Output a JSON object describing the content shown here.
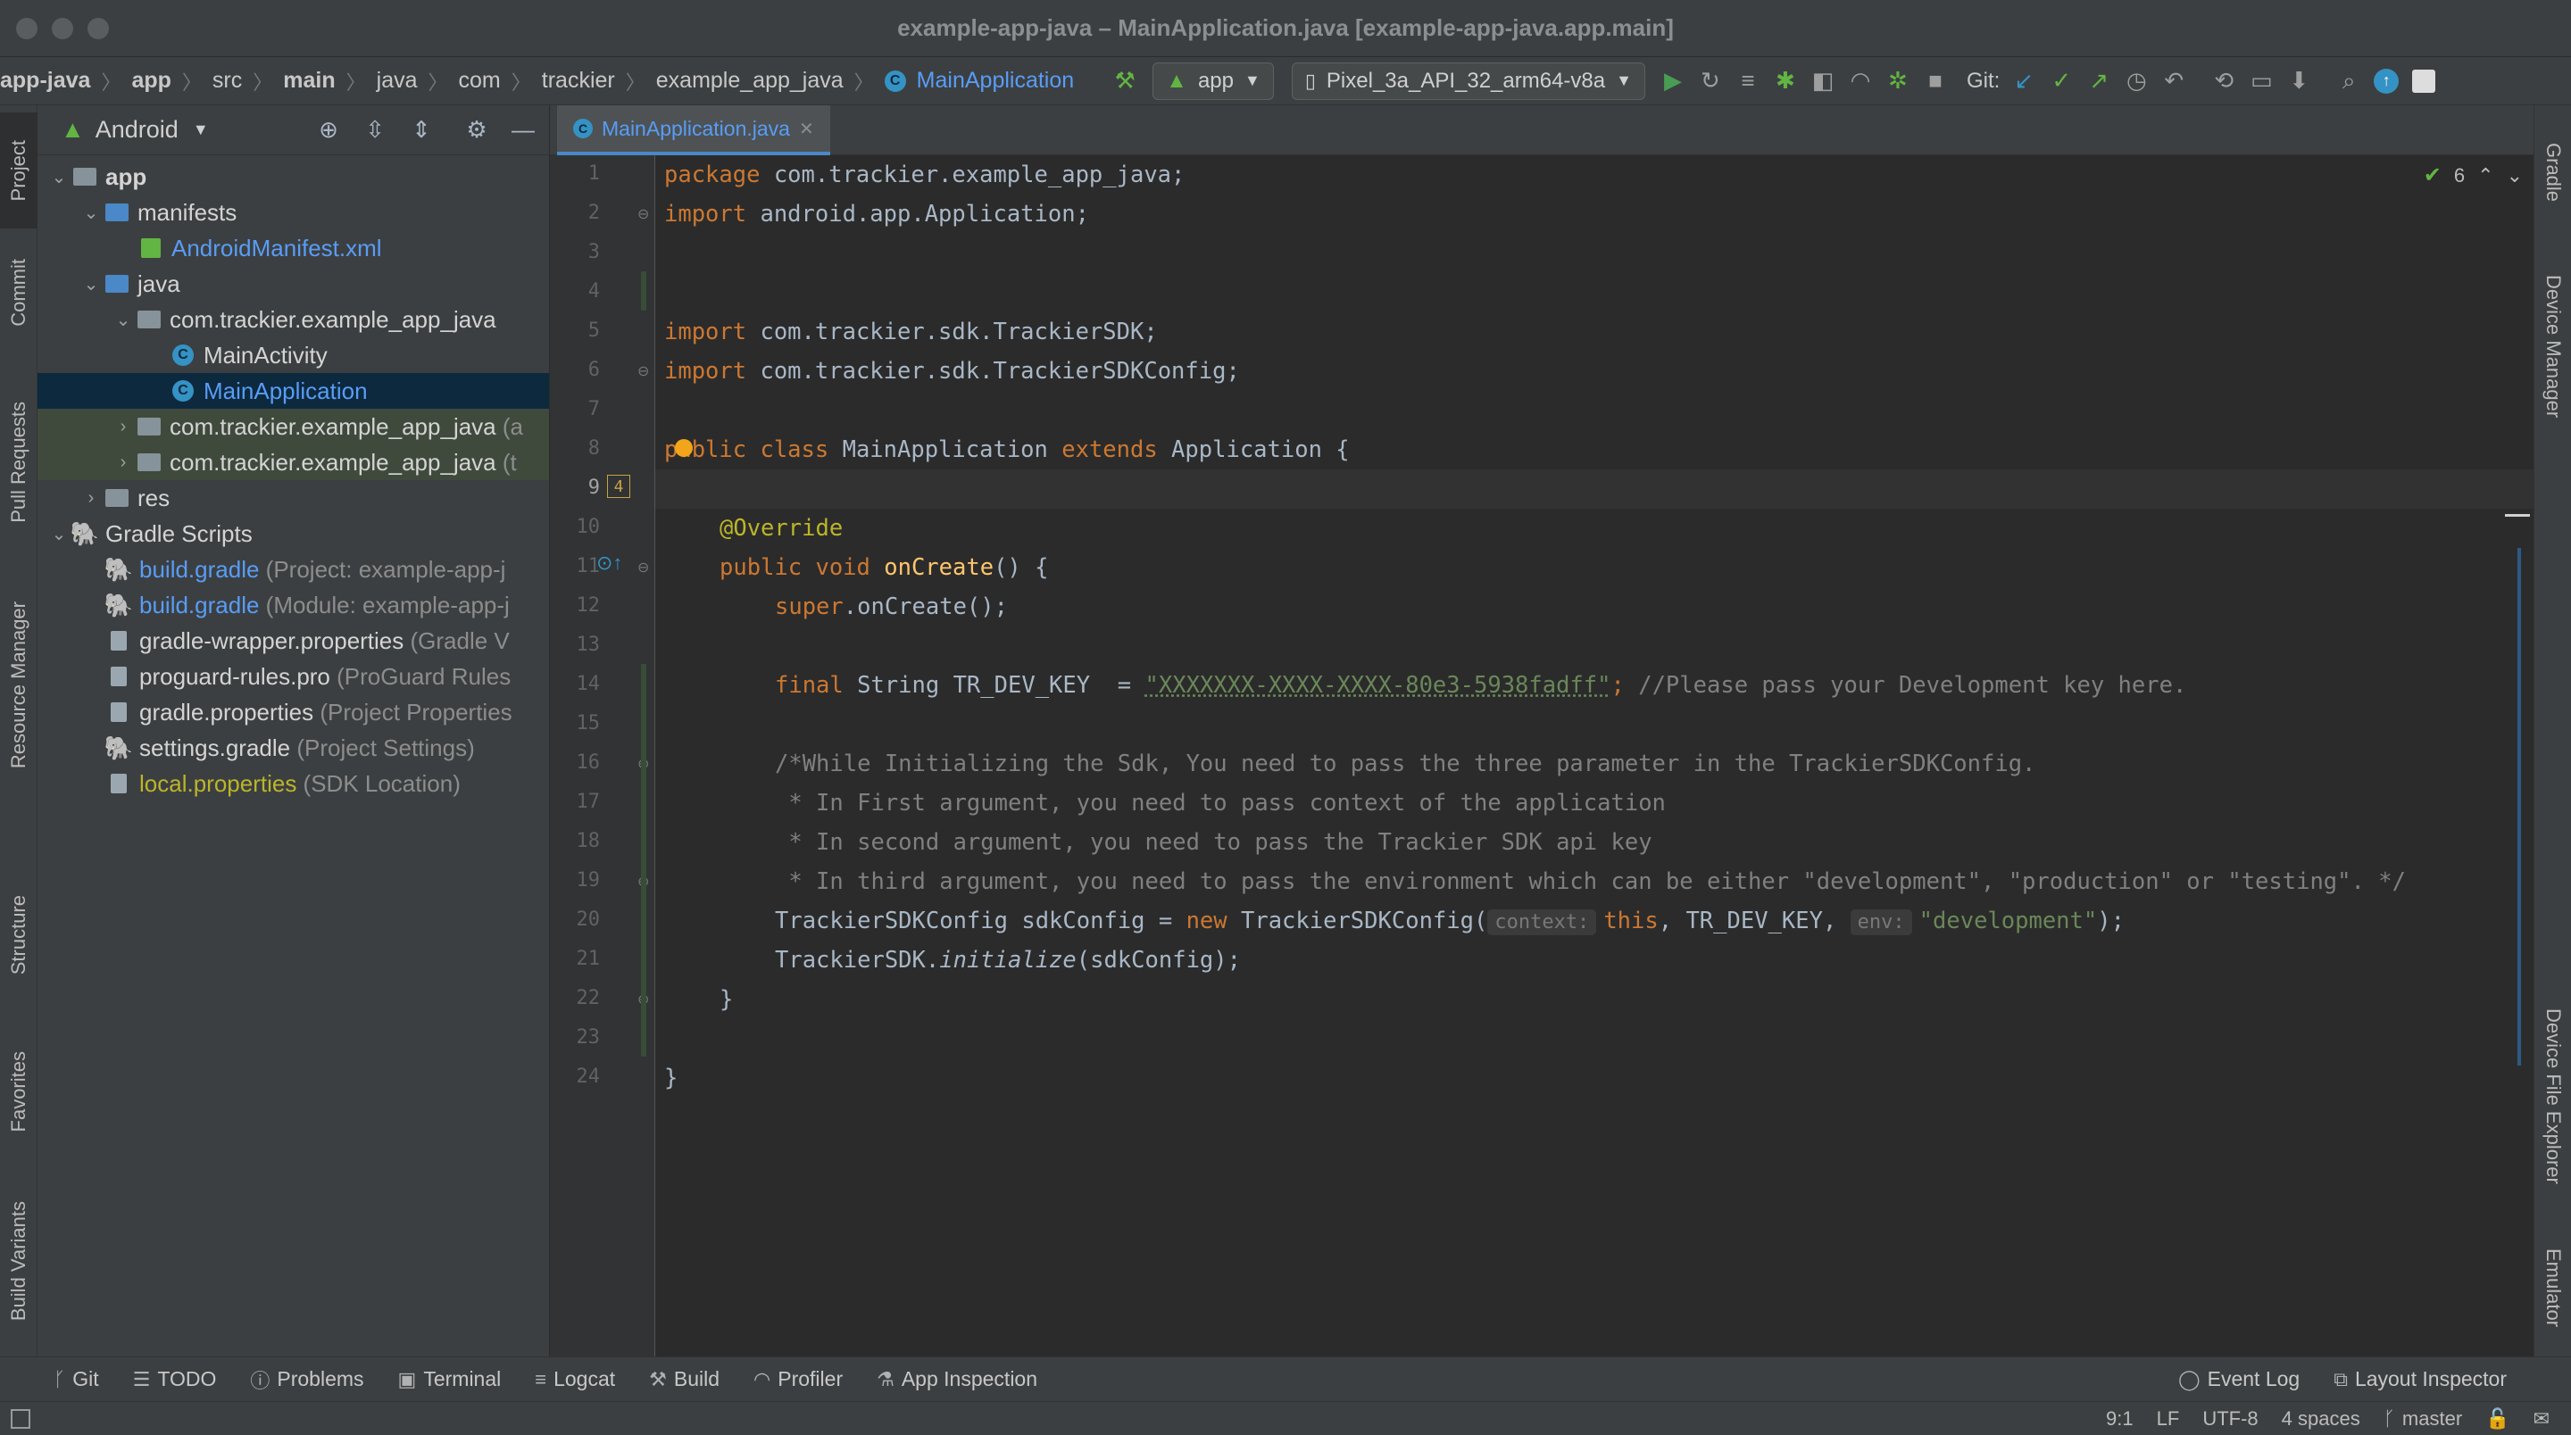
{
  "window": {
    "title": "example-app-java – MainApplication.java [example-app-java.app.main]"
  },
  "breadcrumbs": [
    "app-java",
    "app",
    "src",
    "main",
    "java",
    "com",
    "trackier",
    "example_app_java",
    "MainApplication"
  ],
  "toolbar": {
    "run_config": "app",
    "device": "Pixel_3a_API_32_arm64-v8a",
    "git_label": "Git:"
  },
  "project_panel": {
    "view_mode": "Android",
    "tree": [
      {
        "label": "app",
        "note": ""
      },
      {
        "label": "manifests",
        "note": ""
      },
      {
        "label": "AndroidManifest.xml",
        "note": ""
      },
      {
        "label": "java",
        "note": ""
      },
      {
        "label": "com.trackier.example_app_java",
        "note": ""
      },
      {
        "label": "MainActivity",
        "note": ""
      },
      {
        "label": "MainApplication",
        "note": ""
      },
      {
        "label": "com.trackier.example_app_java",
        "note": "(a"
      },
      {
        "label": "com.trackier.example_app_java",
        "note": "(t"
      },
      {
        "label": "res",
        "note": ""
      },
      {
        "label": "Gradle Scripts",
        "note": ""
      },
      {
        "label": "build.gradle",
        "note": "(Project: example-app-j"
      },
      {
        "label": "build.gradle",
        "note": "(Module: example-app-j"
      },
      {
        "label": "gradle-wrapper.properties",
        "note": "(Gradle V"
      },
      {
        "label": "proguard-rules.pro",
        "note": "(ProGuard Rules"
      },
      {
        "label": "gradle.properties",
        "note": "(Project Properties"
      },
      {
        "label": "settings.gradle",
        "note": "(Project Settings)"
      },
      {
        "label": "local.properties",
        "note": "(SDK Location)"
      }
    ]
  },
  "left_tools": [
    "Project",
    "Commit",
    "Pull Requests",
    "Resource Manager",
    "Structure",
    "Favorites",
    "Build Variants"
  ],
  "right_tools": [
    "Gradle",
    "Device Manager",
    "Device File Explorer",
    "Emulator"
  ],
  "editor": {
    "tab": "MainApplication.java",
    "inspection_count": "6",
    "gutter_badge": "4",
    "line_numbers": [
      "1",
      "2",
      "3",
      "4",
      "5",
      "6",
      "7",
      "8",
      "9",
      "10",
      "11",
      "12",
      "13",
      "14",
      "15",
      "16",
      "17",
      "18",
      "19",
      "20",
      "21",
      "22",
      "23",
      "24"
    ],
    "code": {
      "l1_kw": "package",
      "l1_rest": " com.trackier.example_app_java;",
      "l2_kw": "import",
      "l2_rest": " android.app.Application;",
      "l5_kw": "import",
      "l5_rest": " com.trackier.sdk.TrackierSDK;",
      "l6_kw": "import",
      "l6_rest": " com.trackier.sdk.TrackierSDKConfig;",
      "l8_kw1": "public class",
      "l8_name": " MainApplication ",
      "l8_kw2": "extends",
      "l8_rest": " Application {",
      "l10_ann": "@Override",
      "l11_kw": "public void",
      "l11_fn": "onCreate",
      "l11_rest": "() {",
      "l12_kw": "super",
      "l12_rest": ".onCreate();",
      "l14_kw": "final",
      "l14_mid": " String TR_DEV_KEY  = ",
      "l14_str": "\"XXXXXXX-XXXX-XXXX-80e3-5938fadff\"",
      "l14_semi": ";",
      "l14_cmt": " //Please pass your Development key here.",
      "l16": "/*While Initializing the Sdk, You need to pass the three parameter in the TrackierSDKConfig.",
      "l17": " * In First argument, you need to pass context of the application",
      "l18": " * In second argument, you need to pass the Trackier SDK api key",
      "l19": " * In third argument, you need to pass the environment which can be either \"development\", \"production\" or \"testing\". */",
      "l20_a": "TrackierSDKConfig sdkConfig = ",
      "l20_new": "new",
      "l20_b": " TrackierSDKConfig(",
      "l20_hint1": "context:",
      "l20_this": "this",
      "l20_c": ", TR_DEV_KEY, ",
      "l20_hint2": "env:",
      "l20_str": "\"development\"",
      "l20_end": ");",
      "l21_a": "TrackierSDK.",
      "l21_fn": "initialize",
      "l21_b": "(sdkConfig);",
      "l22": "}",
      "l24": "}"
    }
  },
  "bottom_tools": [
    "Git",
    "TODO",
    "Problems",
    "Terminal",
    "Logcat",
    "Build",
    "Profiler",
    "App Inspection",
    "Event Log",
    "Layout Inspector"
  ],
  "status": {
    "position": "9:1",
    "line_sep": "LF",
    "encoding": "UTF-8",
    "indent": "4 spaces",
    "branch": "master"
  },
  "colors": {
    "accent": "#589df6",
    "keyword": "#cc7832",
    "string": "#6a8759",
    "comment": "#808080",
    "annotation": "#bbb529",
    "function": "#ffc66d",
    "selection": "#0d293e"
  }
}
